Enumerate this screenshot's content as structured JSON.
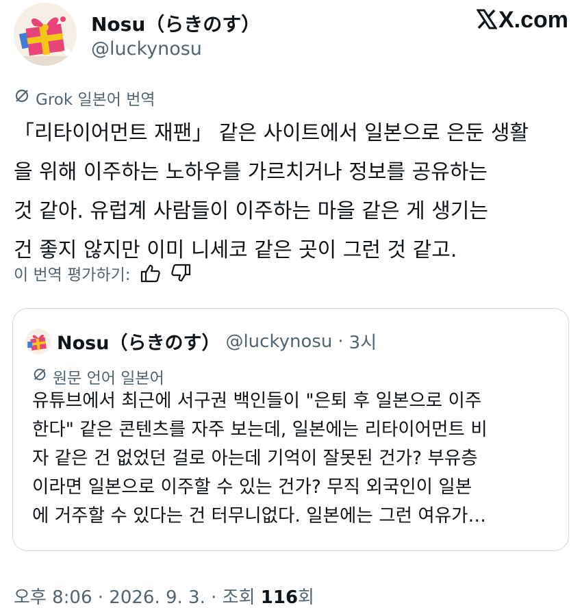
{
  "author": {
    "name": "Nosu（らきのす）",
    "handle": "@luckynosu"
  },
  "brand": {
    "label": "X.com",
    "icon": "x-logo-icon"
  },
  "translation": {
    "label": "Grok 일본어 번역",
    "icon": "grok-icon"
  },
  "translated_lines": [
    "「리타이어먼트 재팬」 같은 사이트에서 일본으로 은둔 생활",
    "을 위해 이주하는 노하우를 가르치거나 정보를 공유하는",
    "것 같아. 유럽계 사람들이 이주하는 마을 같은 게 생기는",
    "건 좋지 않지만 이미 니세코 같은 곳이 그런 것 같고."
  ],
  "rating": {
    "label": "이 번역 평가하기:",
    "like_icon": "thumbs-up-icon",
    "dislike_icon": "thumbs-down-icon"
  },
  "quote": {
    "name": "Nosu（らきのす）",
    "handle": "@luckynosu",
    "separator": "·",
    "time": "3시",
    "original_language": "원문 언어 일본어",
    "lines": [
      "유튜브에서 최근에 서구권 백인들이 \"은퇴 후 일본으로 이주",
      "한다\" 같은 콘텐츠를 자주 보는데, 일본에는 리타이어먼트 비",
      "자 같은 건 없었던 걸로 아는데 기억이 잘못된 건가? 부유층",
      "이라면 일본으로 이주할 수 있는 건가? 무직 외국인이 일본",
      "에 거주할 수 있다는 건 터무니없다. 일본에는 그런 여유가…"
    ]
  },
  "footer": {
    "timestamp": "오후 8:06 · 2026. 9. 3. · 조회 ",
    "views": "116",
    "views_suffix": "회"
  },
  "colors": {
    "text": "#0f1419",
    "secondary": "#536471",
    "border": "#cfd9de",
    "avatar_gift_pink": "#e8447a",
    "avatar_gift_yellow": "#f5c518",
    "avatar_gift_blue": "#3f7bd8"
  }
}
